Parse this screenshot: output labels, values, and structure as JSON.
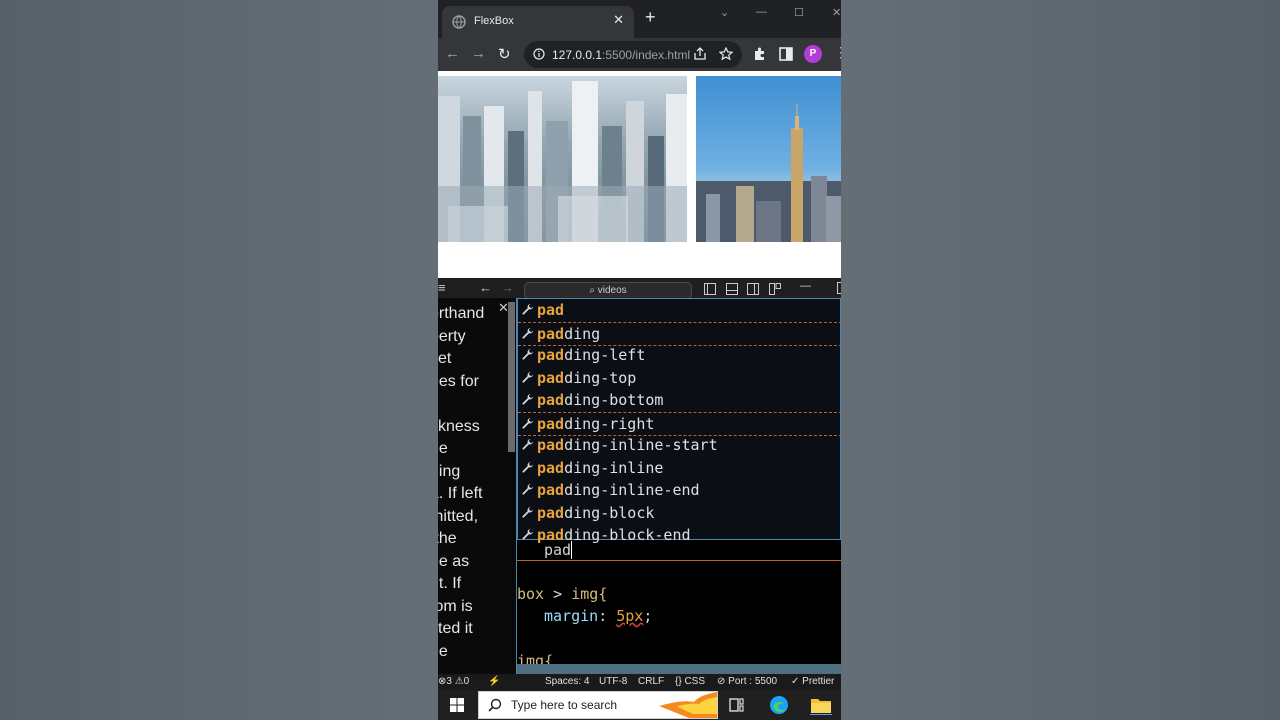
{
  "browser": {
    "tab_title": "FlexBox",
    "tab_close": "✕",
    "new_tab": "+",
    "url_host": "127.0.0.1",
    "url_rest": ":5500/index.html",
    "profile_initial": "P",
    "menu": "⋮",
    "win_min": "—",
    "win_max": "☐",
    "win_close": "✕",
    "nav_back": "←",
    "nav_forward": "→",
    "nav_reload": "↻"
  },
  "vscode": {
    "menu_icon": "≡",
    "back": "←",
    "forward": "→",
    "search_label": "⌕ videos",
    "minimize": "—",
    "doc_close": "✕",
    "doc_lines": [
      "orthand",
      "perty",
      "set",
      "ues for",
      "",
      "ckness",
      "he",
      "ding",
      "a. If left",
      "mitted,",
      " the",
      "ne as",
      "nt. If",
      "tom is",
      "itted it",
      "he"
    ],
    "suggestions": [
      {
        "match": "pad",
        "rest": ""
      },
      {
        "match": "pad",
        "rest": "ding"
      },
      {
        "match": "pad",
        "rest": "ding-left"
      },
      {
        "match": "pad",
        "rest": "ding-top"
      },
      {
        "match": "pad",
        "rest": "ding-bottom"
      },
      {
        "match": "pad",
        "rest": "ding-right"
      },
      {
        "match": "pad",
        "rest": "ding-inline-start"
      },
      {
        "match": "pad",
        "rest": "ding-inline"
      },
      {
        "match": "pad",
        "rest": "ding-inline-end"
      },
      {
        "match": "pad",
        "rest": "ding-block"
      },
      {
        "match": "pad",
        "rest": "ding-block-end"
      }
    ],
    "code": {
      "typed": "pad",
      "selector_1a": "box",
      "selector_1b": " > ",
      "selector_1c": "img{",
      "prop": "margin",
      "colon": ": ",
      "value": "5px",
      "semi": ";",
      "selector_2": "img{"
    },
    "status": {
      "problems": "⊗3 ⚠0",
      "plug": "⚡",
      "spaces": "Spaces: 4",
      "encoding": "UTF-8",
      "eol": "CRLF",
      "lang": "{} CSS",
      "port": "⊘ Port : 5500",
      "prettier": "✓ Prettier"
    }
  },
  "taskbar": {
    "search_placeholder": "Type here to search"
  },
  "colors": {
    "accent_match": "#e8a33c",
    "suggest_border": "#4b86b0",
    "profile": "#b13ed7"
  }
}
